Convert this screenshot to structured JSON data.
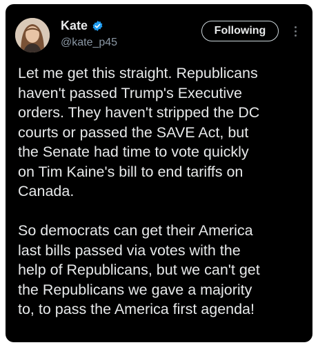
{
  "author": {
    "display_name": "Kate",
    "handle": "@kate_p45",
    "verified": true,
    "verified_color": "#1d9bf0"
  },
  "actions": {
    "follow_label": "Following",
    "more_icon": "more-vertical-icon"
  },
  "tweet": {
    "paragraphs": [
      {
        "lines": [
          "Let me get this straight. Republicans",
          "haven't passed Trump's Executive",
          "orders. They haven't stripped the DC",
          "courts or passed the SAVE Act, but",
          "the Senate had time to vote quickly",
          "on Tim Kaine's bill to end tariffs on",
          "Canada."
        ]
      },
      {
        "lines": [
          "So democrats can get their America",
          "last bills passed via votes with the",
          "help of Republicans, but we can't get",
          "the Republicans we gave a majority",
          "to, to pass the America first agenda!"
        ]
      }
    ]
  },
  "theme": {
    "background": "#000000",
    "text": "#e7e9ea",
    "secondary_text": "#8b98a5"
  }
}
